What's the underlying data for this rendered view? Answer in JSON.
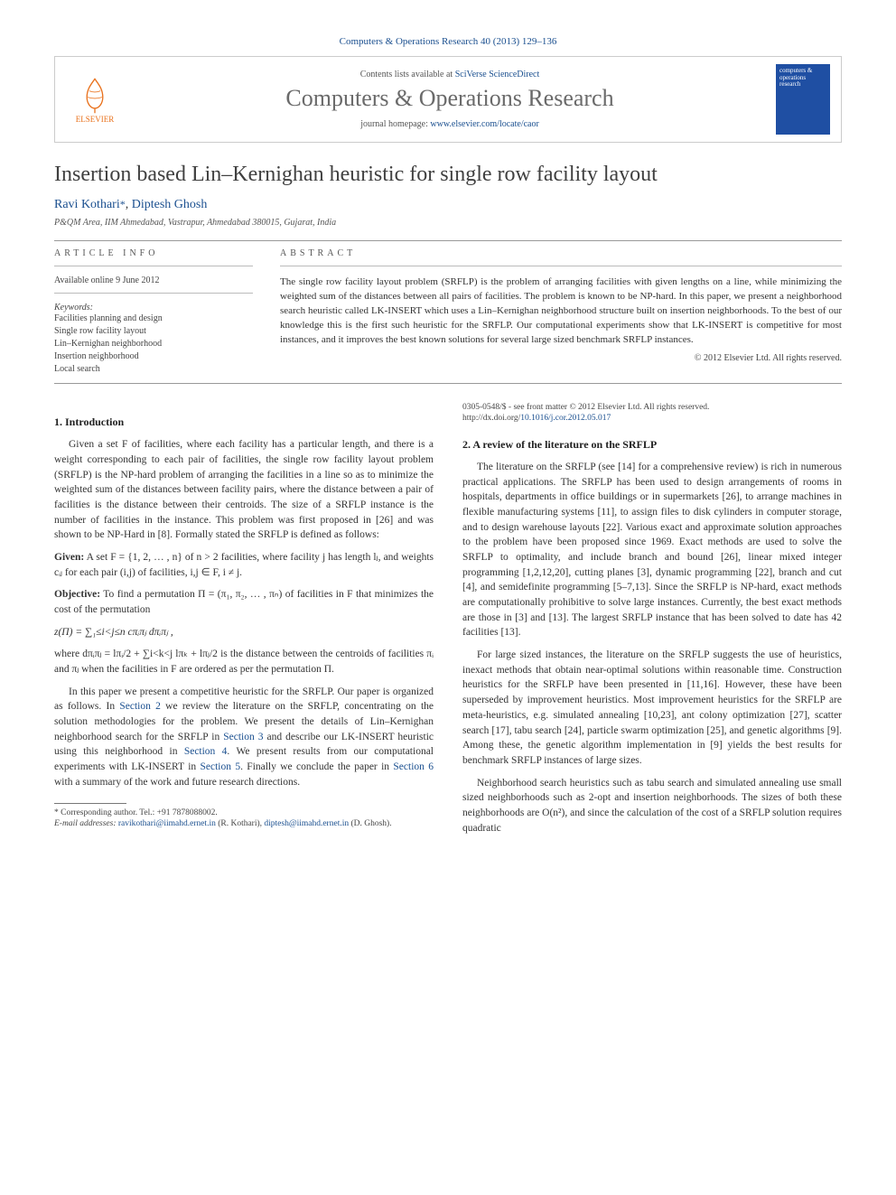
{
  "header": {
    "citation_prefix": "Computers & Operations Research 40 (2013) 129–136",
    "contents_avail_prefix": "Contents lists available at ",
    "contents_link": "SciVerse ScienceDirect",
    "journal_name": "Computers & Operations Research",
    "homepage_prefix": "journal homepage: ",
    "homepage_link": "www.elsevier.com/locate/caor",
    "publisher": "ELSEVIER",
    "cover_text": "computers & operations research"
  },
  "title": "Insertion based Lin–Kernighan heuristic for single row facility layout",
  "authors": {
    "a1": "Ravi Kothari",
    "corr_mark": "*",
    "sep": ", ",
    "a2": "Diptesh Ghosh"
  },
  "affiliation": "P&QM Area, IIM Ahmedabad, Vastrapur, Ahmedabad 380015, Gujarat, India",
  "info": {
    "heading": "ARTICLE INFO",
    "history_line": "Available online 9 June 2012",
    "kw_heading": "Keywords:",
    "keywords": [
      "Facilities planning and design",
      "Single row facility layout",
      "Lin–Kernighan neighborhood",
      "Insertion neighborhood",
      "Local search"
    ]
  },
  "abstract": {
    "heading": "ABSTRACT",
    "text": "The single row facility layout problem (SRFLP) is the problem of arranging facilities with given lengths on a line, while minimizing the weighted sum of the distances between all pairs of facilities. The problem is known to be NP-hard. In this paper, we present a neighborhood search heuristic called LK-INSERT which uses a Lin–Kernighan neighborhood structure built on insertion neighborhoods. To the best of our knowledge this is the first such heuristic for the SRFLP. Our computational experiments show that LK-INSERT is competitive for most instances, and it improves the best known solutions for several large sized benchmark SRFLP instances.",
    "copyright": "© 2012 Elsevier Ltd. All rights reserved."
  },
  "sec1": {
    "heading": "1.  Introduction",
    "p1": "Given a set F of facilities, where each facility has a particular length, and there is a weight corresponding to each pair of facilities, the single row facility layout problem (SRFLP) is the NP-hard problem of arranging the facilities in a line so as to minimize the weighted sum of the distances between facility pairs, where the distance between a pair of facilities is the distance between their centroids. The size of a SRFLP instance is the number of facilities in the instance. This problem was first proposed in [26] and was shown to be NP-Hard in [8]. Formally stated the SRFLP is defined as follows:",
    "given_label": "Given:",
    "given_text": " A set F = {1, 2, … , n} of n > 2 facilities, where facility j has length lⱼ, and weights cᵢⱼ for each pair (i,j) of facilities, i,j ∈ F, i ≠ j.",
    "obj_label": "Objective:",
    "obj_text": " To find a permutation Π = (π₁, π₂, … , πₙ) of facilities in F that minimizes the cost of the permutation",
    "formula": "z(Π) = ∑₁≤i<j≤n cπᵢπⱼ dπᵢπⱼ ,",
    "where": "where dπᵢπⱼ = lπᵢ/2 + ∑i<k<j lπₖ + lπⱼ/2 is the distance between the centroids of facilities πᵢ and πⱼ when the facilities in F are ordered as per the permutation Π.",
    "p2a": "In this paper we present a competitive heuristic for the SRFLP. Our paper is organized as follows. In ",
    "l_sec2": "Section 2",
    "p2b": " we review the literature on the SRFLP, concentrating on the solution methodologies for the problem. We present the details of Lin–Kernighan neighborhood search for the SRFLP in ",
    "l_sec3": "Section 3",
    "p2c": " and describe our LK-INSERT heuristic using this neighborhood in ",
    "l_sec4": "Section 4",
    "p2d": ". We present results from our computational experiments with LK-INSERT in ",
    "l_sec5": "Section 5",
    "p2e": ". Finally we conclude the paper in ",
    "l_sec6": "Section 6",
    "p2f": " with a summary of the work and future research directions."
  },
  "sec2": {
    "heading": "2.  A review of the literature on the SRFLP",
    "p1": "The literature on the SRFLP (see [14] for a comprehensive review) is rich in numerous practical applications. The SRFLP has been used to design arrangements of rooms in hospitals, departments in office buildings or in supermarkets [26], to arrange machines in flexible manufacturing systems [11], to assign files to disk cylinders in computer storage, and to design warehouse layouts [22]. Various exact and approximate solution approaches to the problem have been proposed since 1969. Exact methods are used to solve the SRFLP to optimality, and include branch and bound [26], linear mixed integer programming [1,2,12,20], cutting planes [3], dynamic programming [22], branch and cut [4], and semidefinite programming [5–7,13]. Since the SRFLP is NP-hard, exact methods are computationally prohibitive to solve large instances. Currently, the best exact methods are those in [3] and [13]. The largest SRFLP instance that has been solved to date has 42 facilities [13].",
    "p2": "For large sized instances, the literature on the SRFLP suggests the use of heuristics, inexact methods that obtain near-optimal solutions within reasonable time. Construction heuristics for the SRFLP have been presented in [11,16]. However, these have been superseded by improvement heuristics. Most improvement heuristics for the SRFLP are meta-heuristics, e.g. simulated annealing [10,23], ant colony optimization [27], scatter search [17], tabu search [24], particle swarm optimization [25], and genetic algorithms [9]. Among these, the genetic algorithm implementation in [9] yields the best results for benchmark SRFLP instances of large sizes.",
    "p3": "Neighborhood search heuristics such as tabu search and simulated annealing use small sized neighborhoods such as 2-opt and insertion neighborhoods. The sizes of both these neighborhoods are O(n²), and since the calculation of the cost of a SRFLP solution requires quadratic"
  },
  "footnotes": {
    "corr_label": "* Corresponding author. Tel.: +91 7878088002.",
    "email_label": "E-mail addresses: ",
    "email1": "ravikothari@iimahd.ernet.in",
    "email1_who": " (R. Kothari), ",
    "email2": "diptesh@iimahd.ernet.in",
    "email2_who": " (D. Ghosh).",
    "front": "0305-0548/$ - see front matter © 2012 Elsevier Ltd. All rights reserved.",
    "doi_label": "http://dx.doi.org/",
    "doi": "10.1016/j.cor.2012.05.017"
  }
}
